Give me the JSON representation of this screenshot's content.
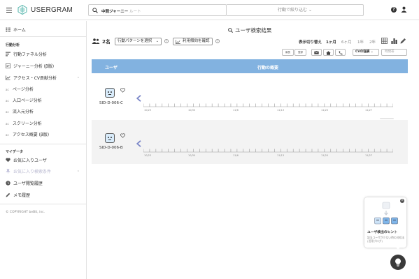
{
  "header": {
    "brand": "USERGRAM",
    "search_scope": "中間ジャーニー",
    "search_placeholder": "ルート",
    "filter_label": "行動で絞り込む ⌄",
    "help_label": "?"
  },
  "sidebar": {
    "home": "ホーム",
    "section_behavior": "行動分析",
    "items": [
      {
        "label": "行動ファネル分析",
        "icon": "funnel-icon"
      },
      {
        "label": "ジャーニー分析 (β版)",
        "icon": "journey-icon"
      },
      {
        "label": "アクセス・CV貢献分析",
        "icon": "chart-icon"
      }
    ],
    "sub_items": [
      {
        "prefix": "ac",
        "label": "ページ分析"
      },
      {
        "prefix": "ac",
        "label": "入口ページ分析"
      },
      {
        "prefix": "ac",
        "label": "流入元分析"
      },
      {
        "prefix": "ac",
        "label": "スクリーン分析"
      },
      {
        "prefix": "ac",
        "label": "アクセス概要 (β版)"
      }
    ],
    "section_mydata": "マイデータ",
    "my_items": [
      {
        "label": "お気に入りユーザ",
        "icon": "heart-icon"
      },
      {
        "label": "お気に入り検索条件",
        "icon": "pin-icon"
      },
      {
        "label": "ユーザ閲覧履歴",
        "icon": "history-icon"
      },
      {
        "label": "メモ履歴",
        "icon": "pencil-icon"
      }
    ],
    "copyright": "© COPYRIGHT beBit, inc."
  },
  "main": {
    "title": "ユーザ検索結果",
    "user_count": "2名",
    "pattern_select": "行動パターンを選択",
    "trend_button": "利用傾向を確認",
    "period_label": "表示切り替え",
    "periods": [
      "1ヶ月",
      "6ヶ月",
      "1年",
      "2年"
    ],
    "active_period": "1ヶ月",
    "mini_buttons": [
      "最長",
      "登録"
    ],
    "cv_select": "CVの強調 ⌄",
    "time_order": "時間帯",
    "columns": [
      "ユーザ",
      "行動の概要"
    ],
    "rows": [
      {
        "sid": "SID-D-006-C",
        "ticks": [
          "10/23",
          "10/30",
          "11/6",
          "11/13",
          "11/20",
          "11/27"
        ]
      },
      {
        "sid": "SID-D-006-B",
        "ticks": [
          "10/23",
          "10/30",
          "11/6",
          "11/13",
          "11/20",
          "11/27"
        ]
      }
    ]
  },
  "hint": {
    "title": "ユーザ検出のヒント",
    "desc": "該当ユーザが少ない時の対処法 (活用ブログ)"
  }
}
